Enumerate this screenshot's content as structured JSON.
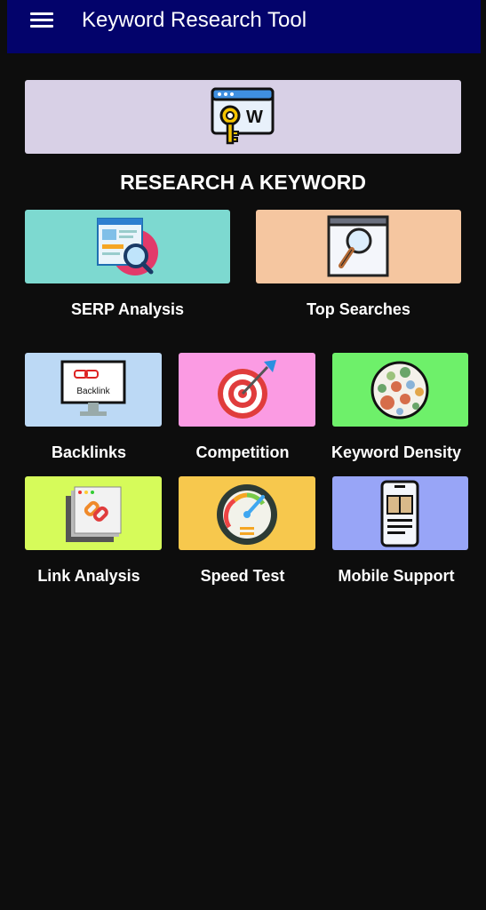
{
  "app": {
    "title": "Keyword Research Tool"
  },
  "section": {
    "title": "RESEARCH A KEYWORD"
  },
  "large_tiles": [
    {
      "label": "SERP Analysis",
      "icon": "serp-analysis-icon",
      "color": "#7dd9d0"
    },
    {
      "label": "Top Searches",
      "icon": "magnifier-window-icon",
      "color": "#f5c6a0"
    }
  ],
  "small_tiles": [
    {
      "label": "Backlinks",
      "icon": "backlink-monitor-icon",
      "color": "#bcd9f5",
      "icon_text": "Backlink"
    },
    {
      "label": "Competition",
      "icon": "target-icon",
      "color": "#fb9be3"
    },
    {
      "label": "Keyword Density",
      "icon": "density-circle-icon",
      "color": "#6ef06a"
    },
    {
      "label": "Link Analysis",
      "icon": "link-pages-icon",
      "color": "#d6fb5a"
    },
    {
      "label": "Speed Test",
      "icon": "speedometer-icon",
      "color": "#f7c84d"
    },
    {
      "label": "Mobile Support",
      "icon": "mobile-document-icon",
      "color": "#98a5f7"
    }
  ],
  "hero": {
    "icon": "keyword-key-icon",
    "color": "#d8d0e6",
    "icon_letter": "W"
  }
}
